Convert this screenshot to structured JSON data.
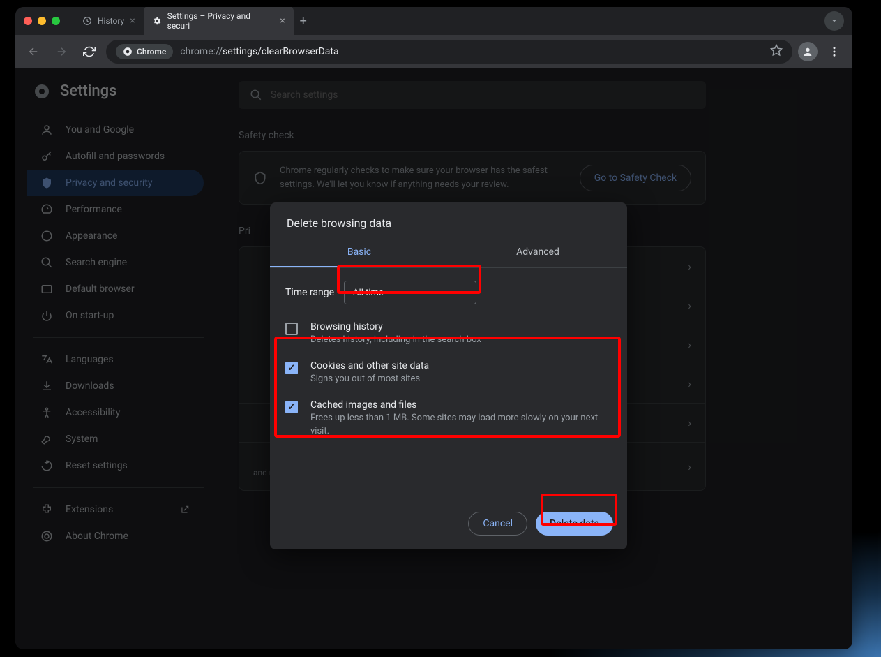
{
  "tabs": {
    "history": "History",
    "settings": "Settings – Privacy and securi"
  },
  "toolbar": {
    "chip": "Chrome",
    "url_prefix": "chrome://",
    "url_suffix": "settings/clearBrowserData"
  },
  "sidebar": {
    "title": "Settings",
    "items": [
      "You and Google",
      "Autofill and passwords",
      "Privacy and security",
      "Performance",
      "Appearance",
      "Search engine",
      "Default browser",
      "On start-up"
    ],
    "items2": [
      "Languages",
      "Downloads",
      "Accessibility",
      "System",
      "Reset settings"
    ],
    "items3": [
      "Extensions",
      "About Chrome"
    ]
  },
  "main": {
    "search_placeholder": "Search settings",
    "safety_title": "Safety check",
    "safety_text": "Chrome regularly checks to make sure your browser has the safest settings. We'll let you know if anything needs your review.",
    "safety_btn": "Go to Safety Check",
    "privacy_title": "Pri",
    "ad_sub": "and more)"
  },
  "dialog": {
    "title": "Delete browsing data",
    "tab_basic": "Basic",
    "tab_advanced": "Advanced",
    "time_label": "Time range",
    "time_value": "All time",
    "rows": [
      {
        "title": "Browsing history",
        "sub": "Deletes history, including in the search box",
        "checked": false
      },
      {
        "title": "Cookies and other site data",
        "sub": "Signs you out of most sites",
        "checked": true
      },
      {
        "title": "Cached images and files",
        "sub": "Frees up less than 1 MB. Some sites may load more slowly on your next visit.",
        "checked": true
      }
    ],
    "cancel": "Cancel",
    "delete": "Delete data"
  }
}
